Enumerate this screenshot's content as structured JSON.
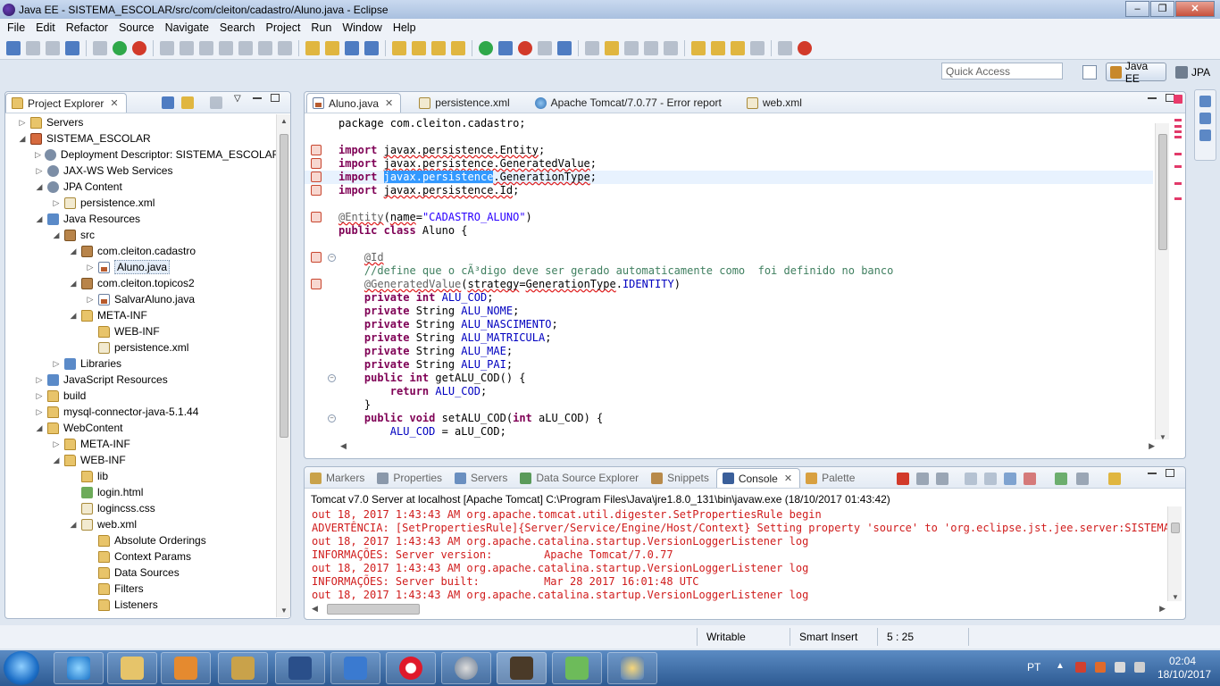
{
  "window": {
    "title": "Java EE - SISTEMA_ESCOLAR/src/com/cleiton/cadastro/Aluno.java - Eclipse",
    "controls": [
      "–",
      "❐",
      "✕"
    ]
  },
  "menu": [
    "File",
    "Edit",
    "Refactor",
    "Source",
    "Navigate",
    "Search",
    "Project",
    "Run",
    "Window",
    "Help"
  ],
  "toolbar": {
    "quick_access_placeholder": "Quick Access",
    "perspectives": [
      "Java EE",
      "JPA"
    ]
  },
  "explorer": {
    "title": "Project Explorer",
    "tree": [
      {
        "label": "Servers",
        "depth": 0,
        "twisty": "▷",
        "icon": "folder"
      },
      {
        "label": "SISTEMA_ESCOLAR",
        "depth": 0,
        "twisty": "◢",
        "icon": "proj"
      },
      {
        "label": "Deployment Descriptor: SISTEMA_ESCOLAR",
        "depth": 1,
        "twisty": "▷",
        "icon": "gear"
      },
      {
        "label": "JAX-WS Web Services",
        "depth": 1,
        "twisty": "▷",
        "icon": "gear"
      },
      {
        "label": "JPA Content",
        "depth": 1,
        "twisty": "◢",
        "icon": "gear"
      },
      {
        "label": "persistence.xml",
        "depth": 2,
        "twisty": "▷",
        "icon": "xml"
      },
      {
        "label": "Java Resources",
        "depth": 1,
        "twisty": "◢",
        "icon": "lib"
      },
      {
        "label": "src",
        "depth": 2,
        "twisty": "◢",
        "icon": "pkg"
      },
      {
        "label": "com.cleiton.cadastro",
        "depth": 3,
        "twisty": "◢",
        "icon": "pkg"
      },
      {
        "label": "Aluno.java",
        "depth": 4,
        "twisty": "▷",
        "icon": "java",
        "selected": true
      },
      {
        "label": "com.cleiton.topicos2",
        "depth": 3,
        "twisty": "◢",
        "icon": "pkg"
      },
      {
        "label": "SalvarAluno.java",
        "depth": 4,
        "twisty": "▷",
        "icon": "java"
      },
      {
        "label": "META-INF",
        "depth": 3,
        "twisty": "◢",
        "icon": "folder"
      },
      {
        "label": "WEB-INF",
        "depth": 4,
        "twisty": "",
        "icon": "folder"
      },
      {
        "label": "persistence.xml",
        "depth": 4,
        "twisty": "",
        "icon": "xml"
      },
      {
        "label": "Libraries",
        "depth": 2,
        "twisty": "▷",
        "icon": "lib"
      },
      {
        "label": "JavaScript Resources",
        "depth": 1,
        "twisty": "▷",
        "icon": "lib"
      },
      {
        "label": "build",
        "depth": 1,
        "twisty": "▷",
        "icon": "folder"
      },
      {
        "label": "mysql-connector-java-5.1.44",
        "depth": 1,
        "twisty": "▷",
        "icon": "folder"
      },
      {
        "label": "WebContent",
        "depth": 1,
        "twisty": "◢",
        "icon": "folder"
      },
      {
        "label": "META-INF",
        "depth": 2,
        "twisty": "▷",
        "icon": "folder"
      },
      {
        "label": "WEB-INF",
        "depth": 2,
        "twisty": "◢",
        "icon": "folder"
      },
      {
        "label": "lib",
        "depth": 3,
        "twisty": "",
        "icon": "folder"
      },
      {
        "label": "login.html",
        "depth": 3,
        "twisty": "",
        "icon": "web"
      },
      {
        "label": "logincss.css",
        "depth": 3,
        "twisty": "",
        "icon": "xml"
      },
      {
        "label": "web.xml",
        "depth": 3,
        "twisty": "◢",
        "icon": "xml"
      },
      {
        "label": "Absolute Orderings",
        "depth": 4,
        "twisty": "",
        "icon": "folder"
      },
      {
        "label": "Context Params",
        "depth": 4,
        "twisty": "",
        "icon": "folder"
      },
      {
        "label": "Data Sources",
        "depth": 4,
        "twisty": "",
        "icon": "folder"
      },
      {
        "label": "Filters",
        "depth": 4,
        "twisty": "",
        "icon": "folder"
      },
      {
        "label": "Listeners",
        "depth": 4,
        "twisty": "",
        "icon": "folder"
      }
    ]
  },
  "editor": {
    "tabs": [
      {
        "label": "Aluno.java",
        "icon": "java",
        "active": true
      },
      {
        "label": "persistence.xml",
        "icon": "xml"
      },
      {
        "label": "Apache Tomcat/7.0.77 - Error report",
        "icon": "globe"
      },
      {
        "label": "web.xml",
        "icon": "xml"
      }
    ],
    "lines": [
      [
        [
          "",
          "package com.cleiton.cadastro;"
        ]
      ],
      [],
      [
        [
          "kw",
          "import"
        ],
        [
          "",
          " "
        ],
        [
          "err",
          "javax.persistence.Entity"
        ],
        [
          "",
          ";"
        ]
      ],
      [
        [
          "kw",
          "import"
        ],
        [
          "",
          " "
        ],
        [
          "err",
          "javax.persistence.GeneratedValue"
        ],
        [
          "",
          ";"
        ]
      ],
      [
        [
          "kw",
          "import"
        ],
        [
          "",
          " "
        ],
        [
          "hl",
          "javax.persistence"
        ],
        [
          "err",
          ".GenerationType"
        ],
        [
          "",
          ";"
        ]
      ],
      [
        [
          "kw",
          "import"
        ],
        [
          "",
          " "
        ],
        [
          "err",
          "javax.persistence.Id"
        ],
        [
          "",
          ";"
        ]
      ],
      [],
      [
        [
          "ann err",
          "@Entity"
        ],
        [
          "",
          "("
        ],
        [
          "err",
          "name"
        ],
        [
          "",
          "="
        ],
        [
          "str",
          "\"CADASTRO_ALUNO\""
        ],
        [
          "",
          ")"
        ]
      ],
      [
        [
          "kw",
          "public class"
        ],
        [
          "",
          " Aluno {"
        ]
      ],
      [],
      [
        [
          "",
          "    "
        ],
        [
          "ann err",
          "@Id"
        ]
      ],
      [
        [
          "cm",
          "    //define que o cÃ³digo deve ser gerado automaticamente como  foi definido no banco"
        ]
      ],
      [
        [
          "",
          "    "
        ],
        [
          "ann err",
          "@GeneratedValue"
        ],
        [
          "",
          "("
        ],
        [
          "err",
          "strategy"
        ],
        [
          "",
          "="
        ],
        [
          "err",
          "GenerationType"
        ],
        [
          "",
          "."
        ],
        [
          "fld",
          "IDENTITY"
        ],
        [
          "",
          ")"
        ]
      ],
      [
        [
          "",
          "    "
        ],
        [
          "kw",
          "private int"
        ],
        [
          "",
          " "
        ],
        [
          "fld",
          "ALU_COD"
        ],
        [
          "",
          ";"
        ]
      ],
      [
        [
          "",
          "    "
        ],
        [
          "kw",
          "private"
        ],
        [
          "",
          " String "
        ],
        [
          "fld",
          "ALU_NOME"
        ],
        [
          "",
          ";"
        ]
      ],
      [
        [
          "",
          "    "
        ],
        [
          "kw",
          "private"
        ],
        [
          "",
          " String "
        ],
        [
          "fld",
          "ALU_NASCIMENTO"
        ],
        [
          "",
          ";"
        ]
      ],
      [
        [
          "",
          "    "
        ],
        [
          "kw",
          "private"
        ],
        [
          "",
          " String "
        ],
        [
          "fld",
          "ALU_MATRICULA"
        ],
        [
          "",
          ";"
        ]
      ],
      [
        [
          "",
          "    "
        ],
        [
          "kw",
          "private"
        ],
        [
          "",
          " String "
        ],
        [
          "fld",
          "ALU_MAE"
        ],
        [
          "",
          ";"
        ]
      ],
      [
        [
          "",
          "    "
        ],
        [
          "kw",
          "private"
        ],
        [
          "",
          " String "
        ],
        [
          "fld",
          "ALU_PAI"
        ],
        [
          "",
          ";"
        ]
      ],
      [
        [
          "",
          "    "
        ],
        [
          "kw",
          "public int"
        ],
        [
          "",
          " getALU_COD() {"
        ]
      ],
      [
        [
          "",
          "        "
        ],
        [
          "kw",
          "return"
        ],
        [
          "",
          " "
        ],
        [
          "fld",
          "ALU_COD"
        ],
        [
          "",
          ";"
        ]
      ],
      [
        [
          "",
          "    }"
        ]
      ],
      [
        [
          "",
          "    "
        ],
        [
          "kw",
          "public void"
        ],
        [
          "",
          " setALU_COD("
        ],
        [
          "kw",
          "int"
        ],
        [
          "",
          " aLU_COD) {"
        ]
      ],
      [
        [
          "",
          "        "
        ],
        [
          "fld",
          "ALU_COD"
        ],
        [
          "",
          " = aLU_COD;"
        ]
      ]
    ],
    "error_lines": [
      2,
      3,
      4,
      5,
      7,
      10,
      12
    ],
    "fold_lines": [
      10,
      19,
      22
    ],
    "current_line": 4
  },
  "console": {
    "tabs": [
      {
        "label": "Markers",
        "active": false
      },
      {
        "label": "Properties",
        "active": false
      },
      {
        "label": "Servers",
        "active": false
      },
      {
        "label": "Data Source Explorer",
        "active": false
      },
      {
        "label": "Snippets",
        "active": false
      },
      {
        "label": "Console",
        "active": true
      },
      {
        "label": "Palette",
        "active": false
      }
    ],
    "title": "Tomcat v7.0 Server at localhost [Apache Tomcat] C:\\Program Files\\Java\\jre1.8.0_131\\bin\\javaw.exe (18/10/2017 01:43:42)",
    "lines": [
      "out 18, 2017 1:43:43 AM org.apache.tomcat.util.digester.SetPropertiesRule begin",
      "ADVERTÊNCIA: [SetPropertiesRule]{Server/Service/Engine/Host/Context} Setting property 'source' to 'org.eclipse.jst.jee.server:SISTEMA_ESC",
      "out 18, 2017 1:43:43 AM org.apache.catalina.startup.VersionLoggerListener log",
      "INFORMAÇÕES: Server version:        Apache Tomcat/7.0.77",
      "out 18, 2017 1:43:43 AM org.apache.catalina.startup.VersionLoggerListener log",
      "INFORMAÇÕES: Server built:          Mar 28 2017 16:01:48 UTC",
      "out 18, 2017 1:43:43 AM org.apache.catalina.startup.VersionLoggerListener log"
    ]
  },
  "status": {
    "writable": "Writable",
    "insert_mode": "Smart Insert",
    "position": "5 : 25"
  },
  "taskbar": {
    "apps": [
      "internet-explorer",
      "file-explorer",
      "media-player",
      "tools",
      "dev-cpp",
      "network",
      "opera",
      "eclipse-like",
      "java-ee-ide",
      "notepad",
      "paint"
    ],
    "language": "PT",
    "time": "02:04",
    "date": "18/10/2017"
  }
}
